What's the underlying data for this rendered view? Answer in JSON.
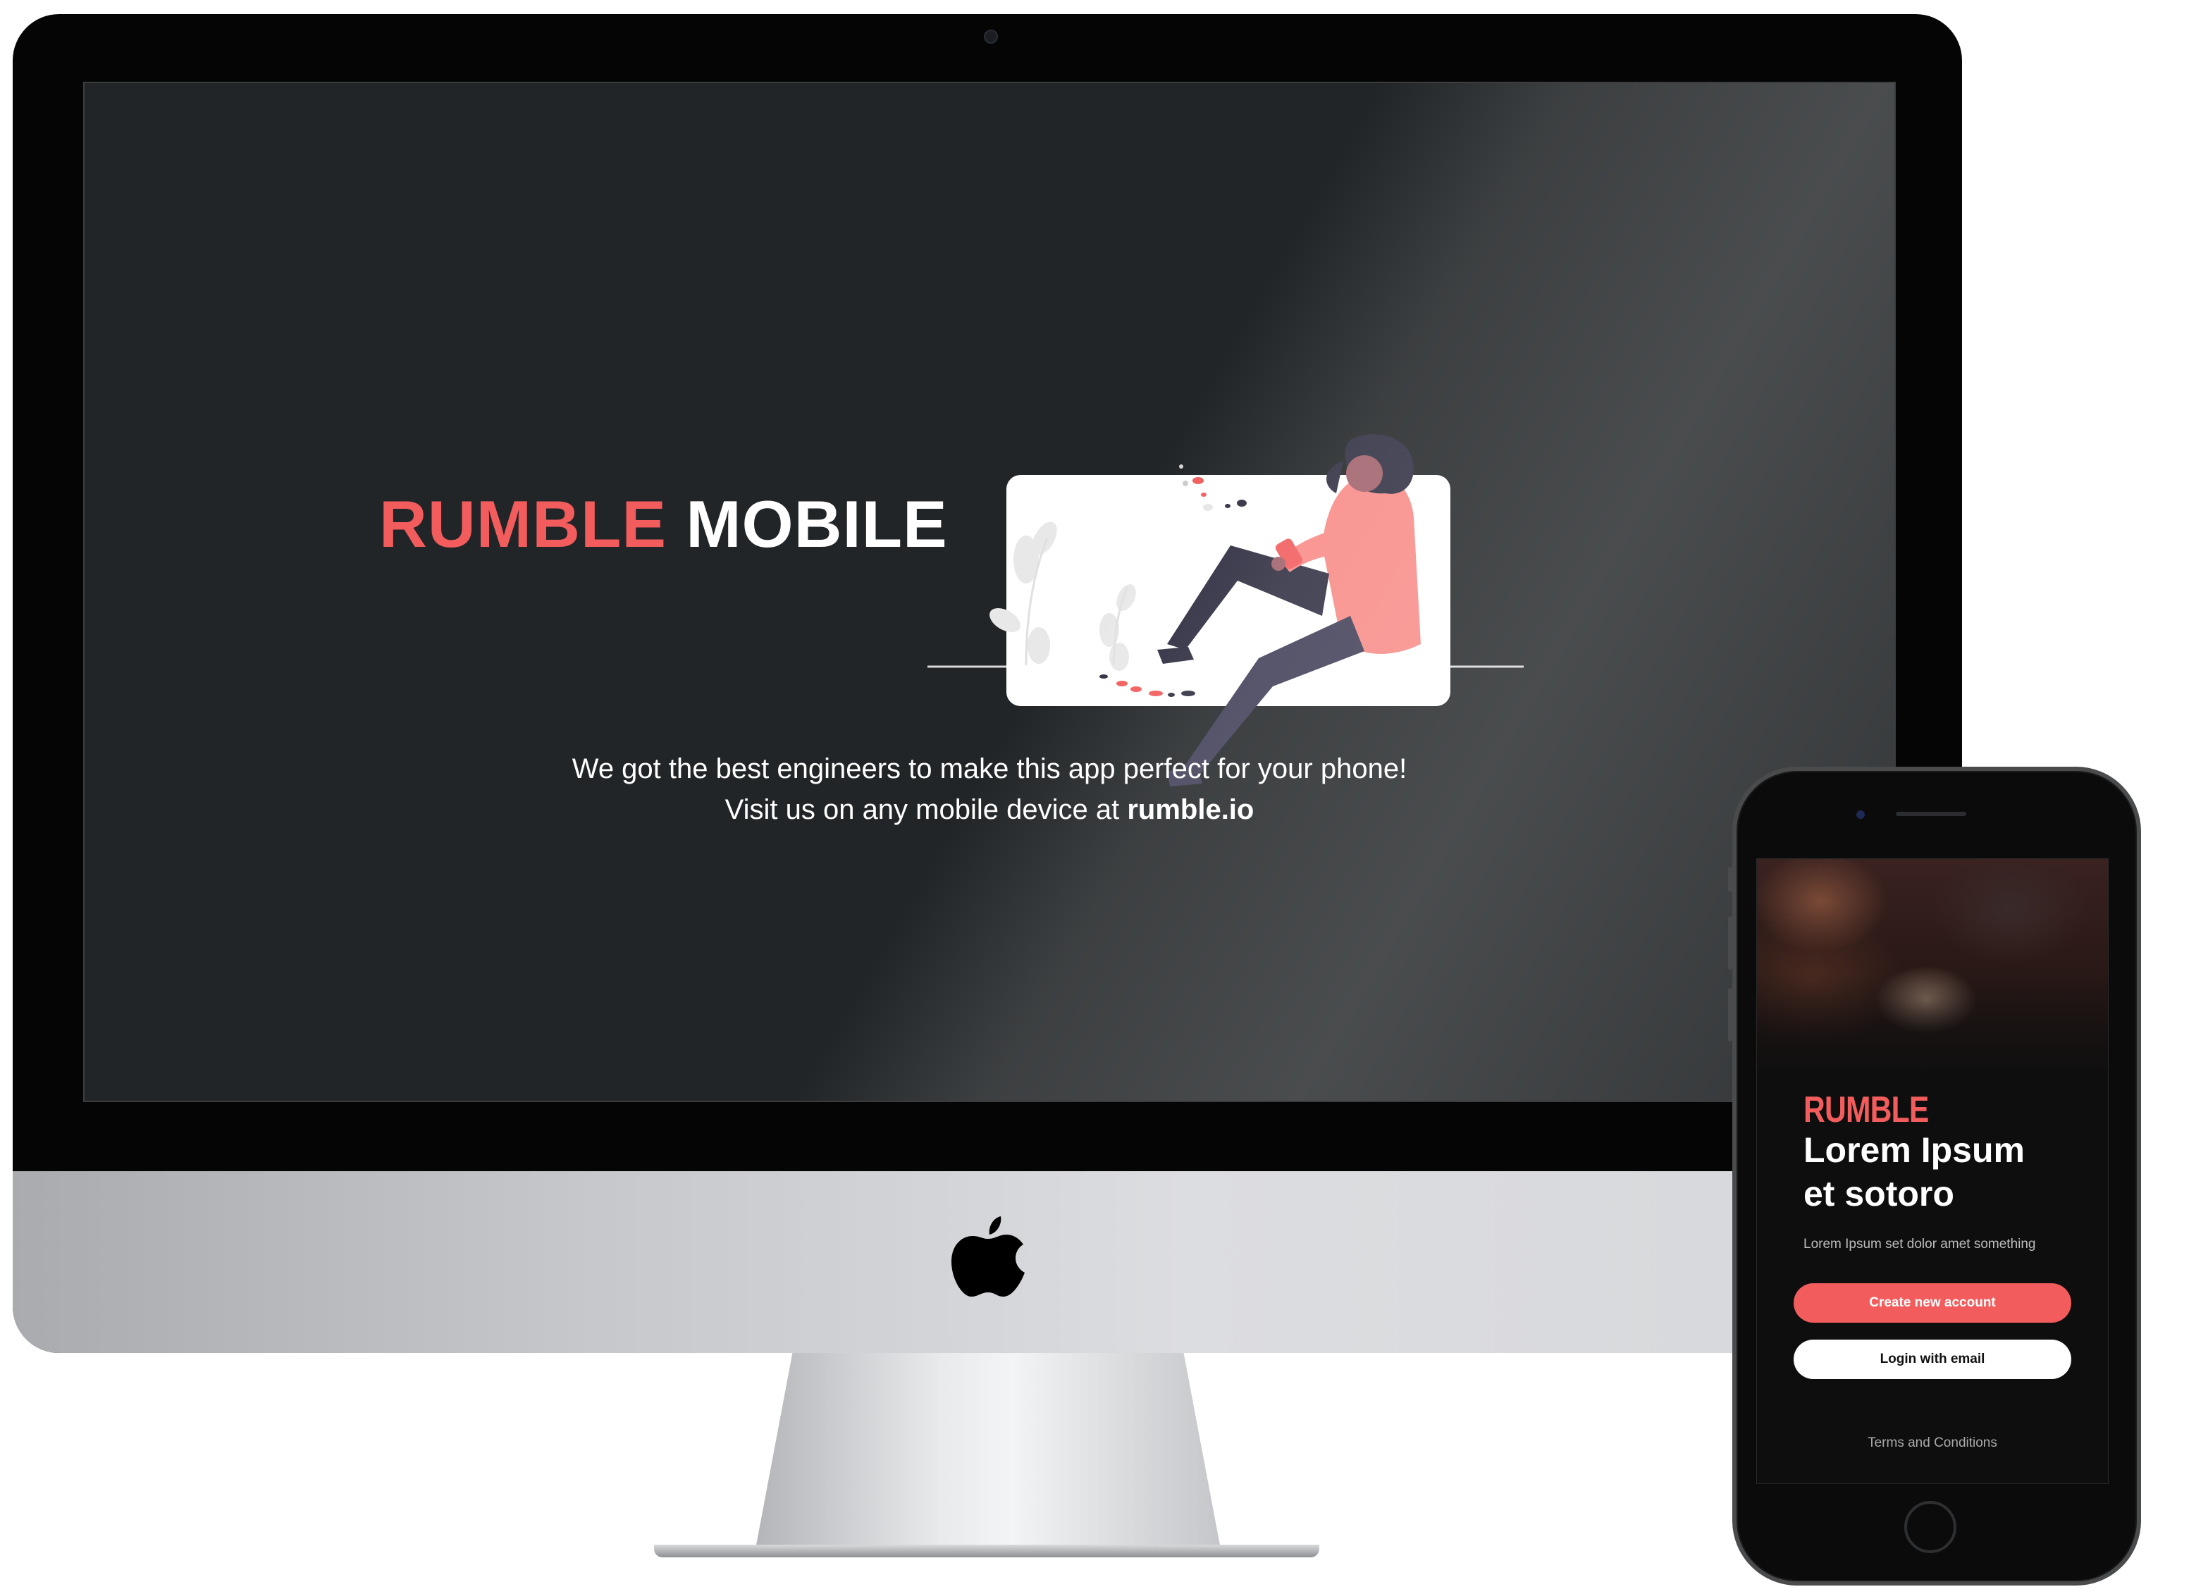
{
  "desktop": {
    "brand_red": "RUMBLE",
    "brand_white": "MOBILE",
    "tagline_line1": "We got the best engineers to make this app perfect for your phone!",
    "tagline_line2_prefix": "Visit us on any mobile device at ",
    "tagline_link": "rumble.io",
    "illustration": "person-sitting-on-screen-illustration",
    "logo_icon": "apple-logo-icon"
  },
  "mobile": {
    "brand": "RUMBLE",
    "heading_line1": "Lorem Ipsum",
    "heading_line2": "et sotoro",
    "subtitle": "Lorem Ipsum set dolor amet something",
    "create_button": "Create new account",
    "login_button": "Login with email",
    "terms_link": "Terms and Conditions"
  },
  "colors": {
    "accent": "#f25c5c",
    "screen_bg": "#222527",
    "text_light": "#ffffff"
  }
}
